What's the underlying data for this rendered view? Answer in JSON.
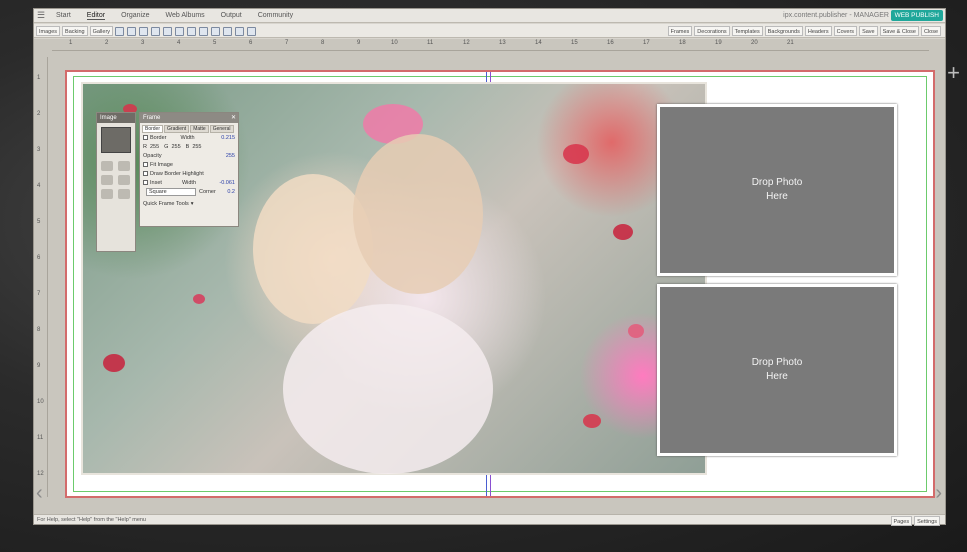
{
  "menubar": {
    "tabs": [
      "Start",
      "Editor",
      "Organize",
      "Web Albums",
      "Output",
      "Community"
    ],
    "active_tab": "Editor",
    "user": "ipx.content.publisher - MANAGER",
    "publish": "WEB PUBLISH"
  },
  "toolbar": {
    "left_buttons": [
      "Images",
      "Backing",
      "Gallery"
    ],
    "right_buttons": [
      "Frames",
      "Decorations",
      "Templates",
      "Backgrounds",
      "Headers",
      "Covers",
      "Save",
      "Save & Close",
      "Close"
    ]
  },
  "ruler": {
    "top": [
      "1",
      "2",
      "3",
      "4",
      "5",
      "6",
      "7",
      "8",
      "9",
      "10",
      "11",
      "12",
      "13",
      "14",
      "15",
      "16",
      "17",
      "18",
      "19",
      "20",
      "21"
    ],
    "left": [
      "1",
      "2",
      "3",
      "4",
      "5",
      "6",
      "7",
      "8",
      "9",
      "10",
      "11",
      "12"
    ]
  },
  "image_panel": {
    "title": "Image"
  },
  "frame_panel": {
    "title": "Frame",
    "tabs": [
      "Border",
      "Gradient",
      "Matte",
      "General"
    ],
    "border_label": "Border",
    "width_label": "Width",
    "width_value": "0.215",
    "r_label": "R",
    "r_value": "255",
    "g_label": "G",
    "g_value": "255",
    "b_label": "B",
    "b_value": "255",
    "opacity_label": "Opacity",
    "opacity_value": "255",
    "fit_image": "Fit Image",
    "draw_border": "Draw Border Highlight",
    "inset": "Inset",
    "inset_width_label": "Width",
    "inset_width_value": "-0.061",
    "shape": "Square",
    "corner_label": "Corner",
    "corner_value": "0.2",
    "quick_tools": "Quick Frame Tools"
  },
  "placeholders": {
    "drop_top": "Drop Photo\nHere",
    "drop_bottom": "Drop Photo\nHere"
  },
  "status": {
    "message": "For Help, select \"Help\" from the \"Help\" menu",
    "right_items": [
      "Pages",
      "Settings"
    ]
  },
  "colors": {
    "publish": "#1fa79a",
    "spread_border": "#d36b6b",
    "guide": "#6ccb6c",
    "center_guide": "#4a5fd1",
    "placeholder": "#7a7a7a"
  }
}
